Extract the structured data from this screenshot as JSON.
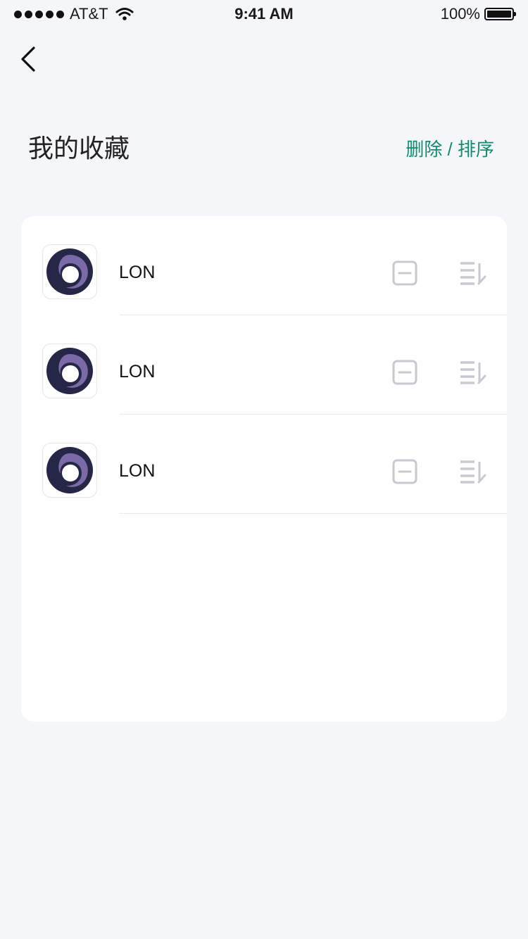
{
  "status_bar": {
    "carrier": "AT&T",
    "time": "9:41 AM",
    "battery": "100%"
  },
  "header": {
    "title": "我的收藏",
    "edit_label": "删除 / 排序"
  },
  "favorites": [
    {
      "name": "LON",
      "icon": "lon-logo-icon"
    },
    {
      "name": "LON",
      "icon": "lon-logo-icon"
    },
    {
      "name": "LON",
      "icon": "lon-logo-icon"
    }
  ],
  "colors": {
    "accent": "#128a6f",
    "background": "#f5f6fa",
    "icon_gray": "#c9c9d2",
    "logo_dark": "#262646",
    "logo_purple": "#7a6ba8"
  }
}
